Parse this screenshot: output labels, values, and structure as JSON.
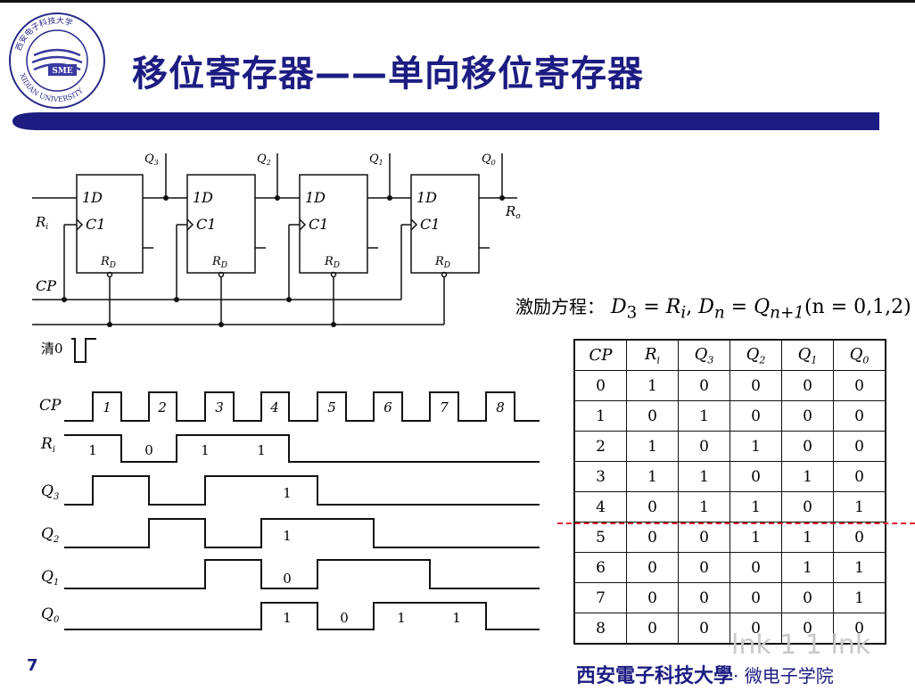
{
  "slide": {
    "title": "移位寄存器——单向移位寄存器",
    "page_number": "7",
    "footer_school": "西安電子科技大學",
    "footer_dept": "· 微电子学院",
    "watermark": "lnk 1 1 lnk"
  },
  "logo": {
    "text_top": "西安电子科技大学",
    "text_bottom": "XIDIAN UNIVERSITY",
    "badge": "SME",
    "colors": {
      "ring": "#2a2a8a",
      "inner": "#3a3aa0"
    }
  },
  "circuit": {
    "ff_labels": {
      "d": "1D",
      "clk": "C1",
      "reset": "R",
      "reset_sub": "D"
    },
    "outputs": [
      {
        "name": "Q",
        "sub": "3"
      },
      {
        "name": "Q",
        "sub": "2"
      },
      {
        "name": "Q",
        "sub": "1"
      },
      {
        "name": "Q",
        "sub": "0"
      }
    ],
    "input": {
      "name": "R",
      "sub": "i"
    },
    "output": {
      "name": "R",
      "sub": "o"
    },
    "clock_label": "CP"
  },
  "excitation": {
    "label": "激励方程：",
    "d": "D",
    "d_sub": "3",
    "eq": "=",
    "r": "R",
    "r_sub": "i",
    "sep": ",",
    "dn": "D",
    "dn_sub": "n",
    "q": "Q",
    "q_sub": "n+1",
    "range": "(n = 0,1,2)"
  },
  "timing": {
    "clear_label": "清0",
    "signals": [
      "CP",
      "R",
      "Q",
      "Q",
      "Q",
      "Q"
    ],
    "signal_subs": [
      "",
      "i",
      "3",
      "2",
      "1",
      "0"
    ],
    "cp_numbers": [
      "1",
      "2",
      "3",
      "4",
      "5",
      "6",
      "7",
      "8"
    ],
    "ri_values": [
      "1",
      "0",
      "1",
      "1"
    ],
    "q3_values": [
      "1"
    ],
    "q2_values": [
      "1"
    ],
    "q1_values": [
      "0"
    ],
    "q0_values": [
      "1",
      "0",
      "1",
      "1"
    ]
  },
  "table": {
    "headers": [
      {
        "name": "CP",
        "sub": ""
      },
      {
        "name": "R",
        "sub": "i"
      },
      {
        "name": "Q",
        "sub": "3"
      },
      {
        "name": "Q",
        "sub": "2"
      },
      {
        "name": "Q",
        "sub": "1"
      },
      {
        "name": "Q",
        "sub": "0"
      }
    ],
    "rows": [
      [
        "0",
        "1",
        "0",
        "0",
        "0",
        "0"
      ],
      [
        "1",
        "0",
        "1",
        "0",
        "0",
        "0"
      ],
      [
        "2",
        "1",
        "0",
        "1",
        "0",
        "0"
      ],
      [
        "3",
        "1",
        "1",
        "0",
        "1",
        "0"
      ],
      [
        "4",
        "0",
        "1",
        "1",
        "0",
        "1"
      ],
      [
        "5",
        "0",
        "0",
        "1",
        "1",
        "0"
      ],
      [
        "6",
        "0",
        "0",
        "0",
        "1",
        "1"
      ],
      [
        "7",
        "0",
        "0",
        "0",
        "0",
        "1"
      ],
      [
        "8",
        "0",
        "0",
        "0",
        "0",
        "0"
      ]
    ]
  },
  "colors": {
    "title": "#1c1c82",
    "bar": "#1c1c82",
    "dash": "#d22233"
  }
}
